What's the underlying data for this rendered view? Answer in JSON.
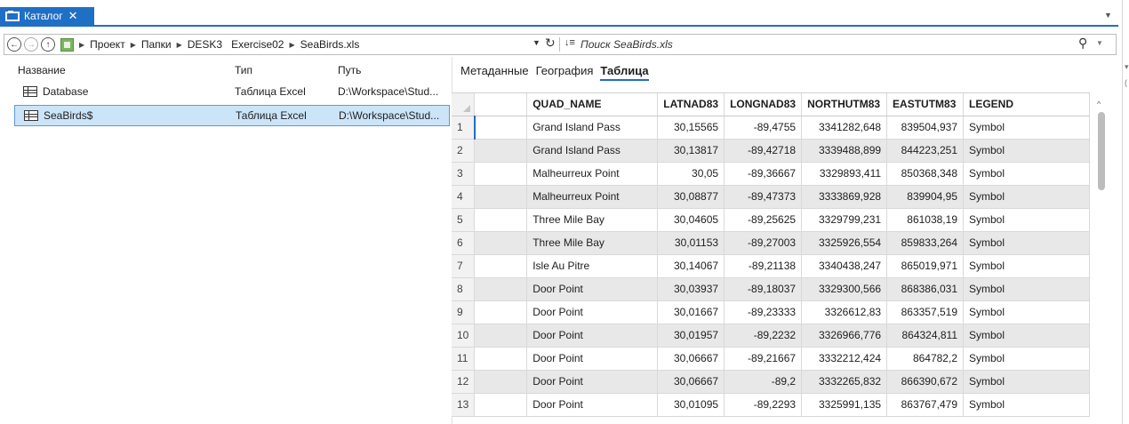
{
  "window": {
    "tab_label": "Каталог",
    "tab_close": "✕"
  },
  "address": {
    "crumbs": [
      "Проект",
      "Папки",
      "DESK3",
      "Exercise02",
      "SeaBirds.xls"
    ],
    "search_placeholder": "Поиск SeaBirds.xls"
  },
  "file_list": {
    "headers": {
      "name": "Название",
      "type": "Тип",
      "path": "Путь"
    },
    "items": [
      {
        "name": "Database",
        "type": "Таблица Excel",
        "path": "D:\\Workspace\\Stud..."
      },
      {
        "name": "SeaBirds$",
        "type": "Таблица Excel",
        "path": "D:\\Workspace\\Stud..."
      }
    ]
  },
  "view_tabs": [
    "Метаданные",
    "География",
    "Таблица"
  ],
  "active_view_tab": "Таблица",
  "table": {
    "columns": [
      "QUAD_NAME",
      "LATNAD83",
      "LONGNAD83",
      "NORTHUTM83",
      "EASTUTM83",
      "LEGEND"
    ],
    "rows": [
      {
        "n": "1",
        "quad": "Grand Island Pass",
        "lat": "30,15565",
        "lon": "-89,4755",
        "north": "3341282,648",
        "east": "839504,937",
        "legend": "Symbol"
      },
      {
        "n": "2",
        "quad": "Grand Island Pass",
        "lat": "30,13817",
        "lon": "-89,42718",
        "north": "3339488,899",
        "east": "844223,251",
        "legend": "Symbol"
      },
      {
        "n": "3",
        "quad": "Malheurreux Point",
        "lat": "30,05",
        "lon": "-89,36667",
        "north": "3329893,411",
        "east": "850368,348",
        "legend": "Symbol"
      },
      {
        "n": "4",
        "quad": "Malheurreux Point",
        "lat": "30,08877",
        "lon": "-89,47373",
        "north": "3333869,928",
        "east": "839904,95",
        "legend": "Symbol"
      },
      {
        "n": "5",
        "quad": "Three Mile Bay",
        "lat": "30,04605",
        "lon": "-89,25625",
        "north": "3329799,231",
        "east": "861038,19",
        "legend": "Symbol"
      },
      {
        "n": "6",
        "quad": "Three Mile Bay",
        "lat": "30,01153",
        "lon": "-89,27003",
        "north": "3325926,554",
        "east": "859833,264",
        "legend": "Symbol"
      },
      {
        "n": "7",
        "quad": "Isle Au Pitre",
        "lat": "30,14067",
        "lon": "-89,21138",
        "north": "3340438,247",
        "east": "865019,971",
        "legend": "Symbol"
      },
      {
        "n": "8",
        "quad": "Door Point",
        "lat": "30,03937",
        "lon": "-89,18037",
        "north": "3329300,566",
        "east": "868386,031",
        "legend": "Symbol"
      },
      {
        "n": "9",
        "quad": "Door Point",
        "lat": "30,01667",
        "lon": "-89,23333",
        "north": "3326612,83",
        "east": "863357,519",
        "legend": "Symbol"
      },
      {
        "n": "10",
        "quad": "Door Point",
        "lat": "30,01957",
        "lon": "-89,2232",
        "north": "3326966,776",
        "east": "864324,811",
        "legend": "Symbol"
      },
      {
        "n": "11",
        "quad": "Door Point",
        "lat": "30,06667",
        "lon": "-89,21667",
        "north": "3332212,424",
        "east": "864782,2",
        "legend": "Symbol"
      },
      {
        "n": "12",
        "quad": "Door Point",
        "lat": "30,06667",
        "lon": "-89,2",
        "north": "3332265,832",
        "east": "866390,672",
        "legend": "Symbol"
      },
      {
        "n": "13",
        "quad": "Door Point",
        "lat": "30,01095",
        "lon": "-89,2293",
        "north": "3325991,135",
        "east": "863767,479",
        "legend": "Symbol"
      }
    ]
  },
  "colors": {
    "accent": "#1f6fc5",
    "selection": "#cce4f7"
  }
}
